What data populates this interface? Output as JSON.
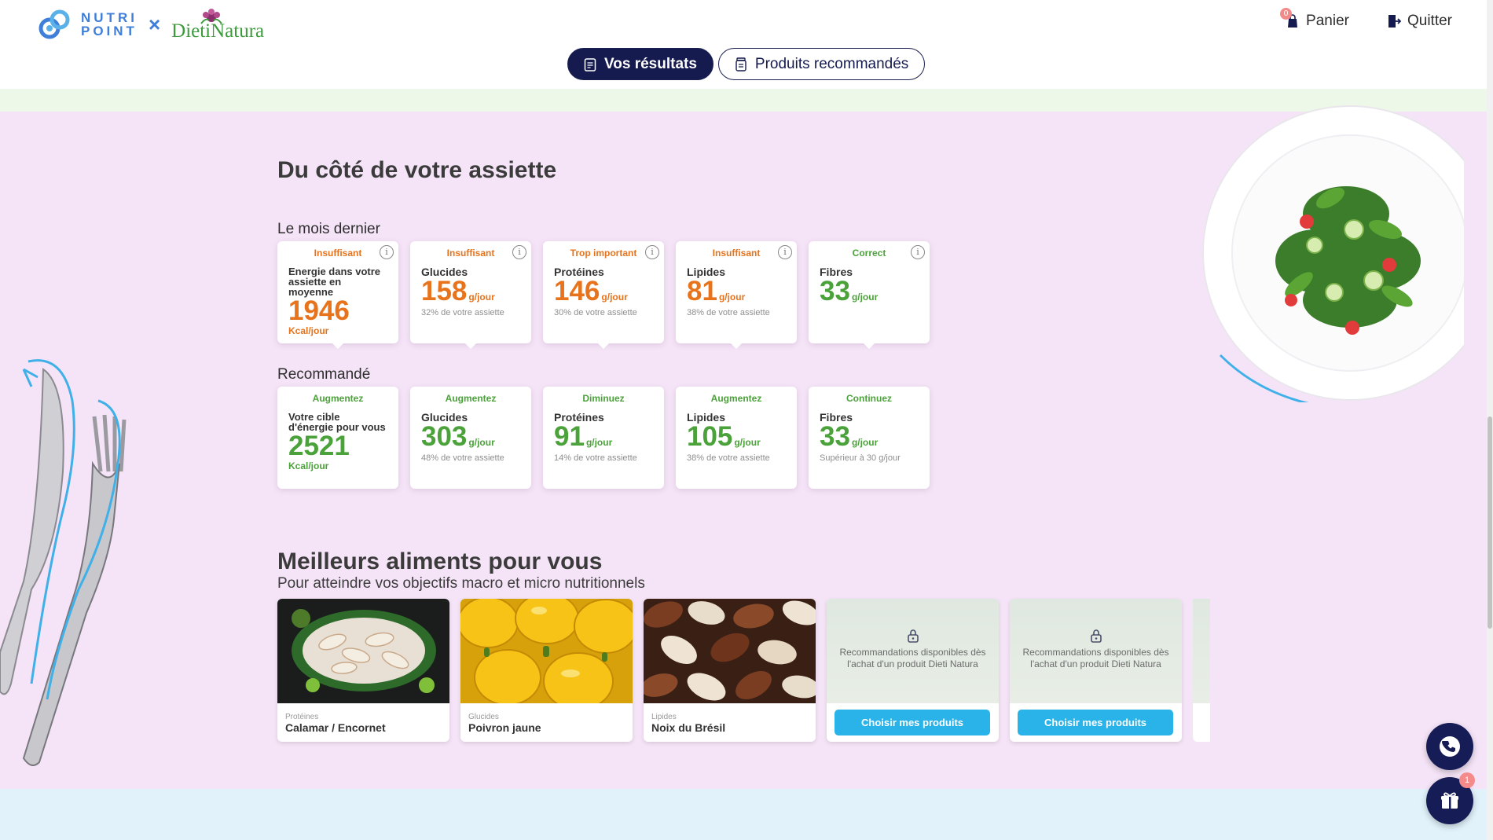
{
  "brand": {
    "nutripoint_line1": "NUTRI",
    "nutripoint_line2": "POINT",
    "separator": "×",
    "dieti_natura": "DietiNatura"
  },
  "header": {
    "cart_label": "Panier",
    "cart_count": "0",
    "logout_label": "Quitter"
  },
  "tabs": [
    {
      "label": "Vos résultats",
      "active": true
    },
    {
      "label": "Produits recommandés",
      "active": false
    }
  ],
  "plate_section": {
    "title": "Du côté de votre assiette",
    "last_month_label": "Le mois dernier",
    "recommended_label": "Recommandé",
    "last_month": [
      {
        "status": "Insuffisant",
        "name": "Energie dans votre assiette en moyenne",
        "value": "1946",
        "unit": "Kcal/jour",
        "note": "",
        "status_color": "orange"
      },
      {
        "status": "Insuffisant",
        "name": "Glucides",
        "value": "158",
        "unit": "g/jour",
        "note": "32% de votre assiette",
        "status_color": "orange"
      },
      {
        "status": "Trop important",
        "name": "Protéines",
        "value": "146",
        "unit": "g/jour",
        "note": "30% de votre assiette",
        "status_color": "orange"
      },
      {
        "status": "Insuffisant",
        "name": "Lipides",
        "value": "81",
        "unit": "g/jour",
        "note": "38% de votre assiette",
        "status_color": "orange"
      },
      {
        "status": "Correct",
        "name": "Fibres",
        "value": "33",
        "unit": "g/jour",
        "note": "",
        "status_color": "green"
      }
    ],
    "recommended": [
      {
        "status": "Augmentez",
        "name": "Votre cible d'énergie pour vous",
        "value": "2521",
        "unit": "Kcal/jour",
        "note": ""
      },
      {
        "status": "Augmentez",
        "name": "Glucides",
        "value": "303",
        "unit": "g/jour",
        "note": "48% de votre assiette"
      },
      {
        "status": "Diminuez",
        "name": "Protéines",
        "value": "91",
        "unit": "g/jour",
        "note": "14% de votre assiette"
      },
      {
        "status": "Augmentez",
        "name": "Lipides",
        "value": "105",
        "unit": "g/jour",
        "note": "38% de votre assiette"
      },
      {
        "status": "Continuez",
        "name": "Fibres",
        "value": "33",
        "unit": "g/jour",
        "note": "Supérieur à 30 g/jour"
      }
    ]
  },
  "best_foods": {
    "title": "Meilleurs aliments pour vous",
    "subtitle": "Pour atteindre vos objectifs macro et micro nutritionnels",
    "items": [
      {
        "category": "Protéines",
        "name": "Calamar / Encornet"
      },
      {
        "category": "Glucides",
        "name": "Poivron jaune"
      },
      {
        "category": "Lipides",
        "name": "Noix du Brésil"
      }
    ],
    "locked_text": "Recommandations disponibles dès l'achat d'un produit Dieti Natura",
    "choose_button": "Choisir mes produits"
  },
  "floating": {
    "gift_badge": "1"
  },
  "colors": {
    "navy": "#151b4f",
    "orange": "#e7731c",
    "green": "#4ba23a",
    "cyan_button": "#2ab3e8",
    "page_band": "#f5e4f7"
  }
}
